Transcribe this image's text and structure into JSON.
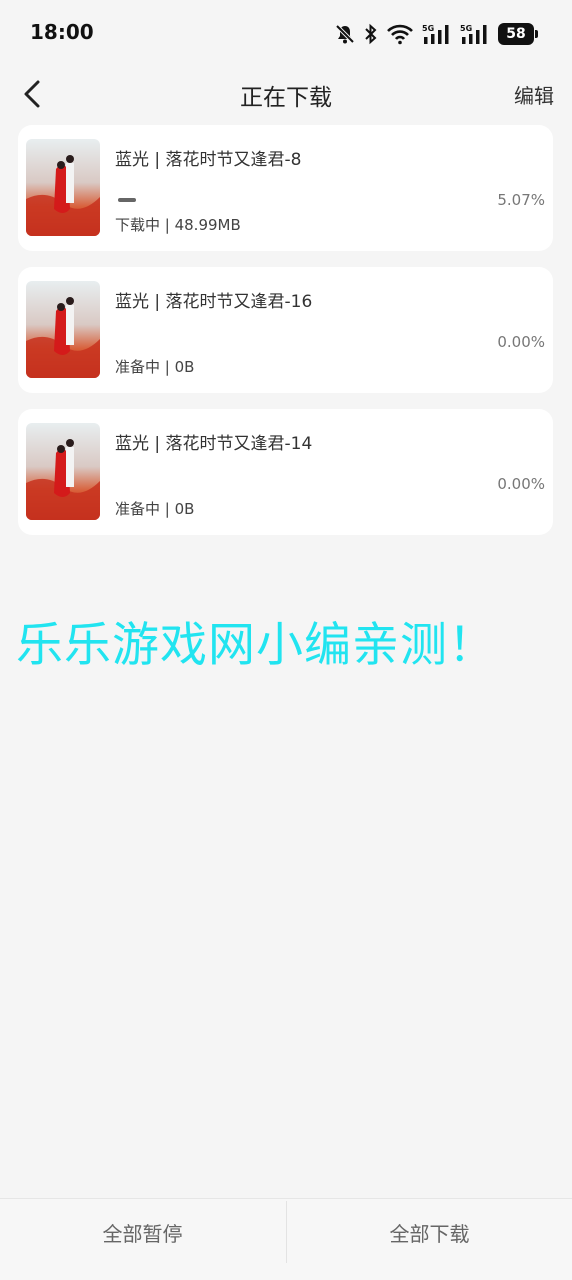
{
  "status_bar": {
    "time": "18:00",
    "icons": [
      "bell-off-icon",
      "bluetooth-icon",
      "wifi-icon",
      "signal-5g-icon",
      "signal-5g-icon"
    ],
    "battery": "58"
  },
  "header": {
    "title": "正在下载",
    "edit_label": "编辑"
  },
  "downloads": [
    {
      "title": "蓝光 | 落花时节又逢君-8",
      "status": "下载中 | 48.99MB",
      "percent": "5.07%",
      "progress": 0.0507
    },
    {
      "title": "蓝光 | 落花时节又逢君-16",
      "status": "准备中 | 0B",
      "percent": "0.00%",
      "progress": 0
    },
    {
      "title": "蓝光 | 落花时节又逢君-14",
      "status": "准备中 | 0B",
      "percent": "0.00%",
      "progress": 0
    }
  ],
  "watermark": "乐乐游戏网小编亲测！",
  "footer": {
    "pause_all": "全部暂停",
    "download_all": "全部下载"
  },
  "colors": {
    "watermark": "#21e4f0",
    "background": "#f5f5f5"
  }
}
